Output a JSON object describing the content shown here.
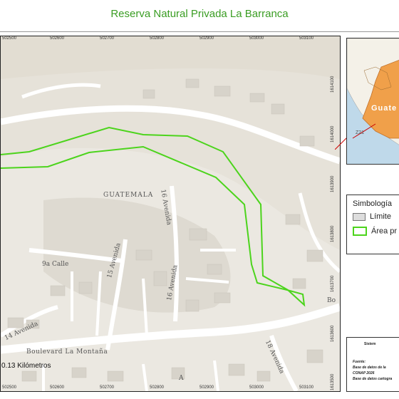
{
  "title": "Reserva Natural Privada La Barranca",
  "map": {
    "coords_top": [
      "502500",
      "502600",
      "502700",
      "502800",
      "502900",
      "503000",
      "503100"
    ],
    "coords_bottom": [
      "502500",
      "502600",
      "502700",
      "502800",
      "502900",
      "503000",
      "503100"
    ],
    "coords_right": [
      "1614100",
      "1614000",
      "1613900",
      "1613800",
      "1613700",
      "1613600",
      "1613500"
    ],
    "place_label": "GUATEMALA",
    "streets": {
      "calle_9a": "9a Calle",
      "avenida_15": "15 Avenida",
      "avenida_16_upper": "16 Avenida",
      "avenida_16_lower": "16 Avenida",
      "avenida_14": "14 Avenida",
      "avenida_18": "18 Avenida",
      "boulevard": "Boulevard La Montaña",
      "bo_fragment": "Bo",
      "a_fragment": "A"
    },
    "scale_label": "0.13 Kilómetros",
    "colors": {
      "reserve_outline": "#4cd41c",
      "terrain": "#e7e4dd",
      "road": "#ffffff",
      "building": "#d8d4cc"
    }
  },
  "locator": {
    "label_country": "Guate",
    "label_number": "Z21",
    "colors": {
      "sea": "#bfd9ea",
      "land": "#f4f1e8",
      "country": "#f0a04a",
      "pointer": "#cc0000"
    }
  },
  "legend": {
    "title": "Simbología",
    "items": [
      {
        "label": "Límite",
        "swatch_fill": "#dddddd",
        "swatch_stroke": "#777777"
      },
      {
        "label": "Área pr",
        "swatch_fill": "#ffffff",
        "swatch_stroke": "#4cd41c"
      }
    ]
  },
  "info": {
    "system_label": "Sistem",
    "source_lines": [
      "Fuente:",
      "Base de datos de la",
      "CONAP 2026",
      "Base de datos cartogra"
    ]
  }
}
